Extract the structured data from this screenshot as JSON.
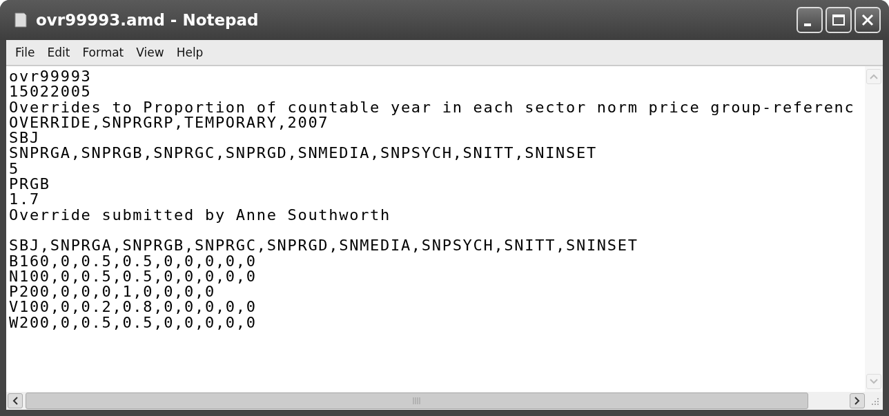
{
  "window": {
    "title": "ovr99993.amd - Notepad"
  },
  "menu": [
    "File",
    "Edit",
    "Format",
    "View",
    "Help"
  ],
  "document": {
    "blocks": [
      [
        "ovr99993",
        "15022005",
        "Overrides to Proportion of countable year in each sector norm price group-referenc",
        "OVERRIDE,SNPRGRP,TEMPORARY,2007",
        "SBJ",
        "SNPRGA,SNPRGB,SNPRGC,SNPRGD,SNMEDIA,SNPSYCH,SNITT,SNINSET",
        "5",
        "PRGB",
        "1.7",
        "Override submitted by Anne Southworth"
      ],
      [
        "SBJ,SNPRGA,SNPRGB,SNPRGC,SNPRGD,SNMEDIA,SNPSYCH,SNITT,SNINSET",
        "B160,0,0.5,0.5,0,0,0,0,0",
        "N100,0,0.5,0.5,0,0,0,0,0",
        "P200,0,0,0,1,0,0,0,0",
        "V100,0,0.2,0.8,0,0,0,0,0",
        "W200,0,0.5,0.5,0,0,0,0,0"
      ]
    ]
  }
}
